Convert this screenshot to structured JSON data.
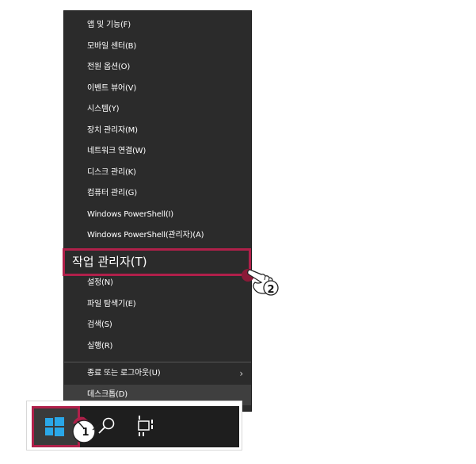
{
  "menu": {
    "items": [
      {
        "label": "앱 및 기능(F)"
      },
      {
        "label": "모바일 센터(B)"
      },
      {
        "label": "전원 옵션(O)"
      },
      {
        "label": "이벤트 뷰어(V)"
      },
      {
        "label": "시스템(Y)"
      },
      {
        "label": "장치 관리자(M)"
      },
      {
        "label": "네트워크 연결(W)"
      },
      {
        "label": "디스크 관리(K)"
      },
      {
        "label": "컴퓨터 관리(G)"
      },
      {
        "label": "Windows PowerShell(I)"
      },
      {
        "label": "Windows PowerShell(관리자)(A)"
      },
      {
        "label": "작업 관리자(T)"
      },
      {
        "label": "설정(N)"
      },
      {
        "label": "파일 탐색기(E)"
      },
      {
        "label": "검색(S)"
      },
      {
        "label": "실행(R)"
      },
      {
        "label": "종료 또는 로그아웃(U)"
      },
      {
        "label": "데스크톱(D)"
      }
    ],
    "submenu_arrow": "›"
  },
  "steps": {
    "step1": "1",
    "step2": "2"
  },
  "taskbar": {
    "start_icon": "windows-logo-icon",
    "search_icon": "search-icon",
    "taskview_icon": "task-view-icon"
  },
  "colors": {
    "menu_bg": "#2b2b2b",
    "highlight": "#b0204a",
    "taskbar_bg": "#1e1e1e",
    "windows_blue": "#2aa7e8"
  }
}
